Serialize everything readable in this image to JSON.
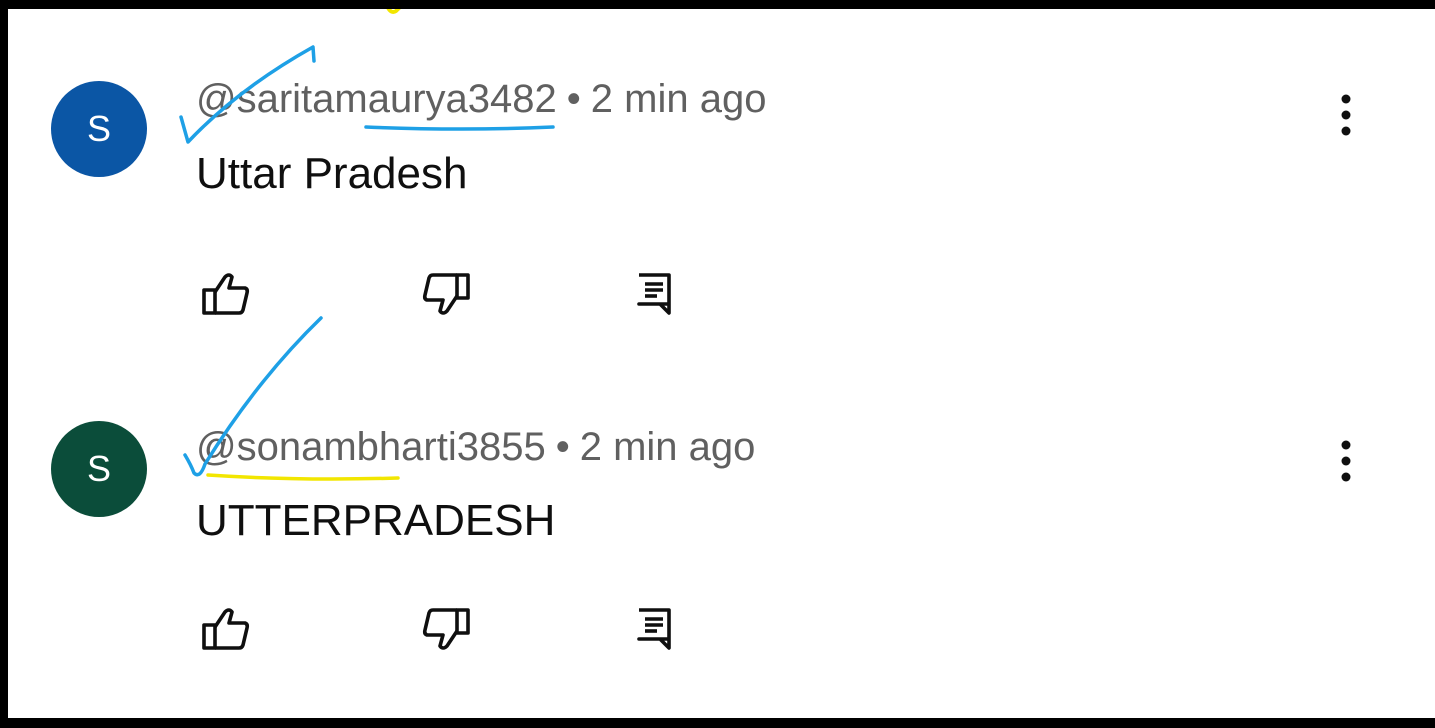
{
  "comments": [
    {
      "avatar_letter": "S",
      "avatar_color": "#0b56a5",
      "handle": "@saritamaurya3482",
      "separator": "•",
      "time": "2 min ago",
      "text": "Uttar Pradesh"
    },
    {
      "avatar_letter": "S",
      "avatar_color": "#0b4d3a",
      "handle": "@sonambharti3855",
      "separator": "•",
      "time": "2 min ago",
      "text": "UTTERPRADESH"
    }
  ],
  "icons": {
    "like": "thumb-up-outline",
    "dislike": "thumb-down-outline",
    "reply": "comment-reply",
    "more": "more-vertical"
  },
  "annotation_colors": {
    "blue": "#1ea0e6",
    "yellow": "#f2e600"
  }
}
